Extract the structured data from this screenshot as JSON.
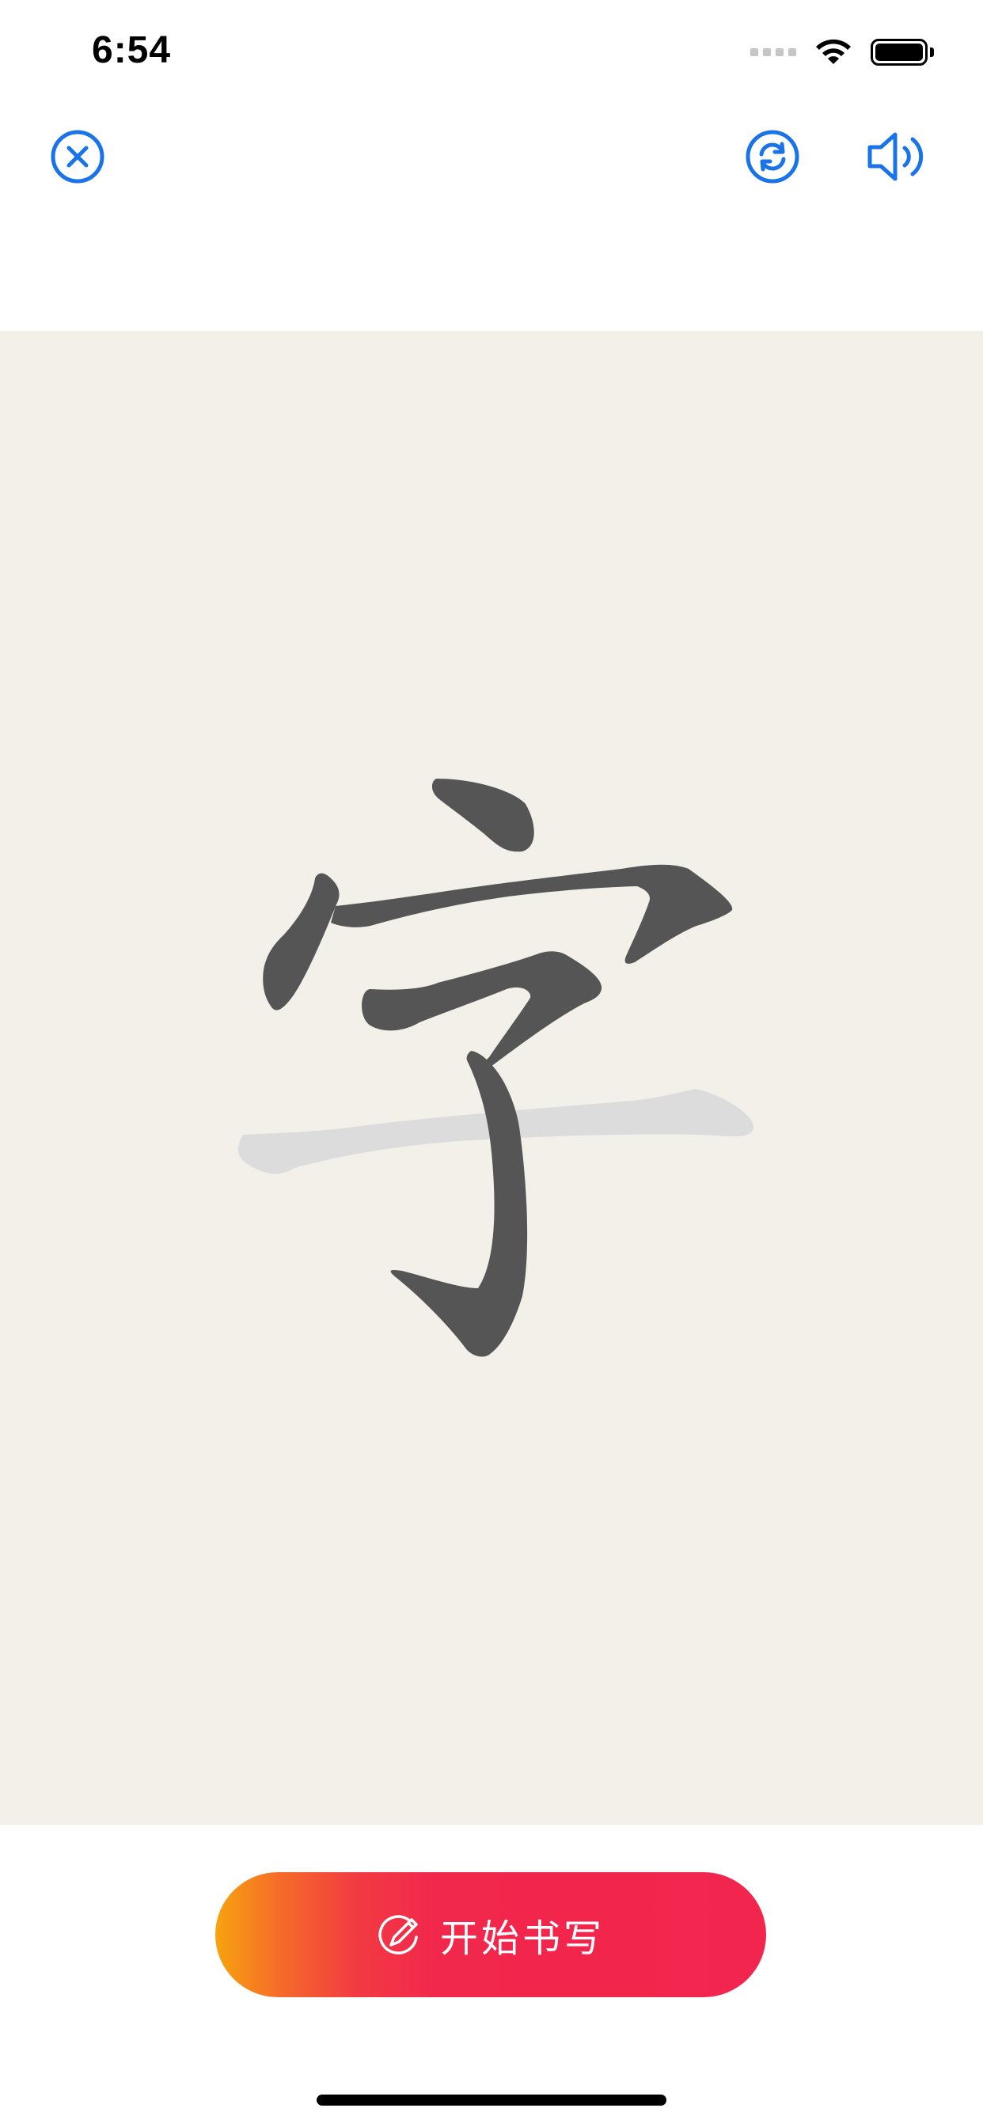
{
  "status_bar": {
    "time": "6:54"
  },
  "toolbar": {
    "close_icon": "close-circle-icon",
    "refresh_icon": "refresh-icon",
    "sound_icon": "speaker-icon"
  },
  "canvas": {
    "character": "宇",
    "background_color": "#f2f0e9",
    "stroke_color": "#555555",
    "guide_stroke_color": "#dcdcdc"
  },
  "start_button": {
    "label": "开始书写",
    "icon": "pen-icon",
    "gradient_start": "#f7a30f",
    "gradient_end": "#f2254e"
  },
  "colors": {
    "accent": "#1a73e8"
  }
}
